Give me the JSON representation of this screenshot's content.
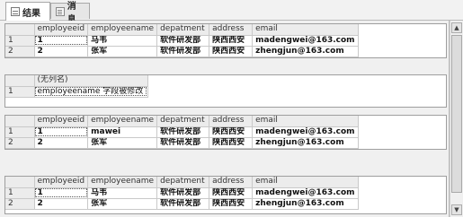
{
  "tabs": [
    {
      "label": "结果",
      "icon": "grid-icon"
    },
    {
      "label": "消息",
      "icon": "message-icon"
    }
  ],
  "grids": [
    {
      "columns": [
        "employeeid",
        "employeename",
        "depatment",
        "address",
        "email"
      ],
      "rows": [
        {
          "num": "1",
          "cells": [
            "1",
            "马韦",
            "软件研发部",
            "陕西西安",
            "madengwei@163.com"
          ]
        },
        {
          "num": "2",
          "cells": [
            "2",
            "张军",
            "软件研发部",
            "陕西西安",
            "zhengjun@163.com"
          ]
        }
      ]
    },
    {
      "columns": [
        "(无列名)"
      ],
      "rows": [
        {
          "num": "1",
          "cells": [
            "employeename 字段被修改"
          ]
        }
      ]
    },
    {
      "columns": [
        "employeeid",
        "employeename",
        "depatment",
        "address",
        "email"
      ],
      "rows": [
        {
          "num": "1",
          "cells": [
            "1",
            "mawei",
            "软件研发部",
            "陕西西安",
            "madengwei@163.com"
          ]
        },
        {
          "num": "2",
          "cells": [
            "2",
            "张军",
            "软件研发部",
            "陕西西安",
            "zhengjun@163.com"
          ]
        }
      ]
    },
    {
      "columns": [
        "employeeid",
        "employeename",
        "depatment",
        "address",
        "email"
      ],
      "rows": [
        {
          "num": "1",
          "cells": [
            "1",
            "马韦",
            "软件研发部",
            "陕西西安",
            "madengwei@163.com"
          ]
        },
        {
          "num": "2",
          "cells": [
            "2",
            "张军",
            "软件研发部",
            "陕西西安",
            "zhengjun@163.com"
          ]
        }
      ]
    }
  ],
  "scrollbar": {
    "up_glyph": "▲",
    "down_glyph": "▼"
  }
}
